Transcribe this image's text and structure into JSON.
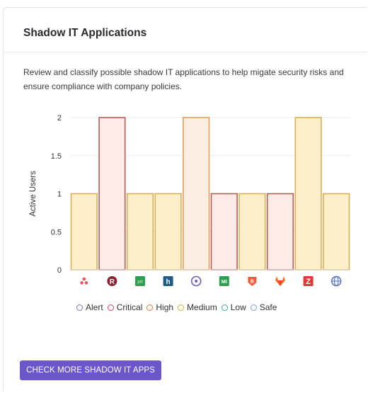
{
  "card": {
    "title": "Shadow IT Applications",
    "description": "Review and classify possible shadow IT applications to help migate security risks and ensure compliance with company policies.",
    "button_label": "CHECK MORE SHADOW IT APPS"
  },
  "chart_data": {
    "type": "bar",
    "ylabel": "Active Users",
    "ylim": [
      0,
      2
    ],
    "yticks": [
      "0",
      "0.5",
      "1",
      "1.5",
      "2"
    ],
    "grid": true,
    "categories": [
      "asana-icon",
      "r-icon",
      "pd-icon",
      "h-icon",
      "target-icon",
      "mi-icon",
      "b-icon",
      "gitlab-icon",
      "z-icon",
      "globe-icon"
    ],
    "values": [
      1,
      2,
      1,
      1,
      2,
      1,
      1,
      1,
      2,
      1
    ],
    "risk": [
      "Medium",
      "Critical",
      "Medium",
      "Medium",
      "High",
      "Critical",
      "Medium",
      "Critical",
      "Medium",
      "Medium"
    ]
  },
  "legend": [
    {
      "label": "Alert",
      "color": "#7b6fd0"
    },
    {
      "label": "Critical",
      "color": "#d0485a"
    },
    {
      "label": "High",
      "color": "#e07a3a"
    },
    {
      "label": "Medium",
      "color": "#d8ae3c"
    },
    {
      "label": "Low",
      "color": "#3bae8a"
    },
    {
      "label": "Safe",
      "color": "#7aa0d8"
    }
  ],
  "colors": {
    "accent": "#6c56c9",
    "critical_stroke": "#b95a5a",
    "critical_fill": "#fcebe6",
    "high_stroke": "#e0a060",
    "high_fill": "#fdeee3",
    "medium_stroke": "#d8b056",
    "medium_fill": "#fdefc9"
  }
}
